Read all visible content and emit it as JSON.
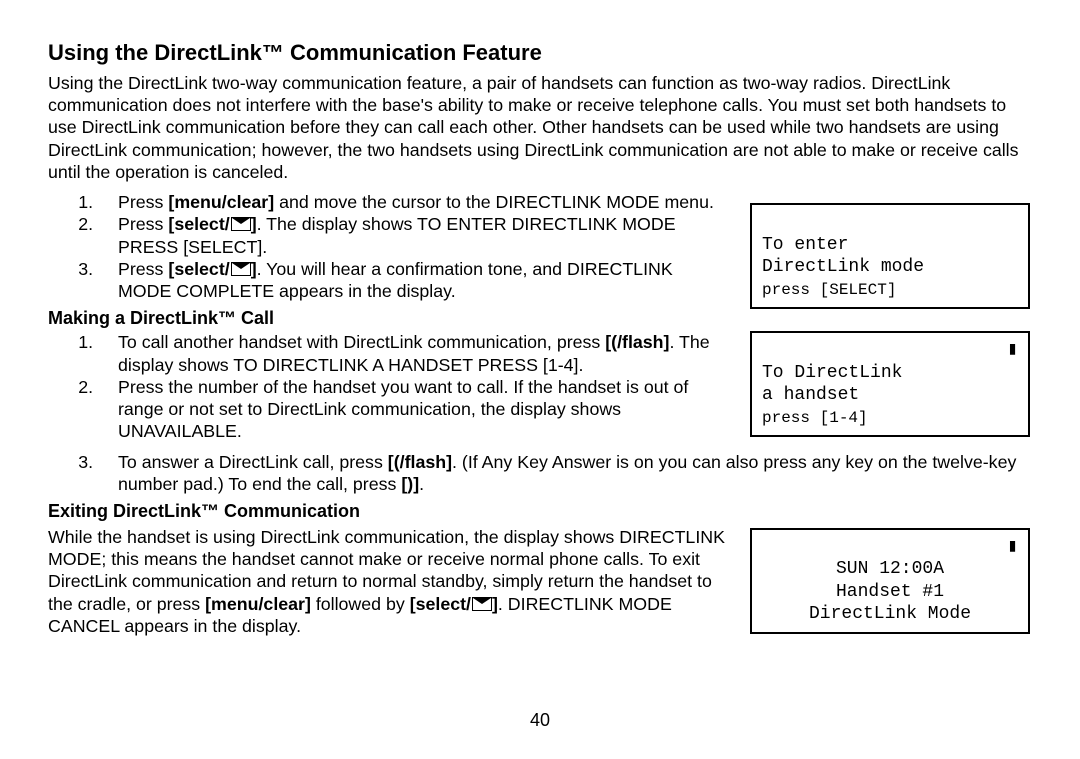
{
  "title": "Using the DirectLink™ Communication Feature",
  "intro": "Using the DirectLink two-way communication feature, a pair of handsets can function as two-way radios. DirectLink communication does not interfere with the base's ability to make or receive telephone calls. You must set both handsets to use DirectLink communication before they can call each other. Other handsets can be used while two handsets are using DirectLink communication; however, the two handsets using DirectLink communication are not able to make or receive calls until the operation is canceled.",
  "steps_a": {
    "1_pre": "Press ",
    "1_bold": "[menu/clear]",
    "1_post": " and move the cursor to the DIRECTLINK MODE menu.",
    "2_pre": "Press ",
    "2_bold": "[select/",
    "2_post": ". The display shows TO ENTER DIRECTLINK MODE PRESS [SELECT].",
    "3_pre": "Press ",
    "3_bold": "[select/",
    "3_post": ". You will hear a confirmation tone, and DIRECTLINK MODE COMPLETE appears in the display."
  },
  "lcd1": {
    "l1": "To enter",
    "l2": "DirectLink mode",
    "l3": "press [SELECT]"
  },
  "h2_making": "Making a DirectLink™ Call",
  "steps_b": {
    "1_pre": "To call another handset with DirectLink communication, press ",
    "1_bold": "[ /flash]",
    "1_post": ". The display shows TO DIRECTLINK A HANDSET PRESS [1-4].",
    "2": "Press the number of the handset you want to call. If the handset is out of range or not set to DirectLink communication, the display shows UNAVAILABLE.",
    "3_pre": "To answer a DirectLink call, press ",
    "3_bold": "[ /flash]",
    "3_mid": ". (If Any Key Answer is on you can also press any key on the twelve-key number pad.) To end the call, press ",
    "3_bold2": "[ ]",
    "3_post": "."
  },
  "lcd2": {
    "l1": "To DirectLink",
    "l2": "a handset",
    "l3": "press [1-4]",
    "bat": "▮"
  },
  "h2_exiting": "Exiting DirectLink™ Communication",
  "exit_para_pre": "While the handset is using DirectLink communication, the display shows DIRECTLINK MODE; this means the handset cannot make or receive normal phone calls. To exit DirectLink communication and return to normal standby, simply return the handset to the cradle, or press ",
  "exit_bold1": "[menu/clear]",
  "exit_mid": " followed by ",
  "exit_bold2": "[select/",
  "exit_post": ". DIRECTLINK MODE CANCEL appears in the display.",
  "lcd3": {
    "l1": "SUN 12:00A",
    "l2": "Handset #1",
    "l3": "DirectLink Mode",
    "bat": "▮"
  },
  "pagenum": "40"
}
